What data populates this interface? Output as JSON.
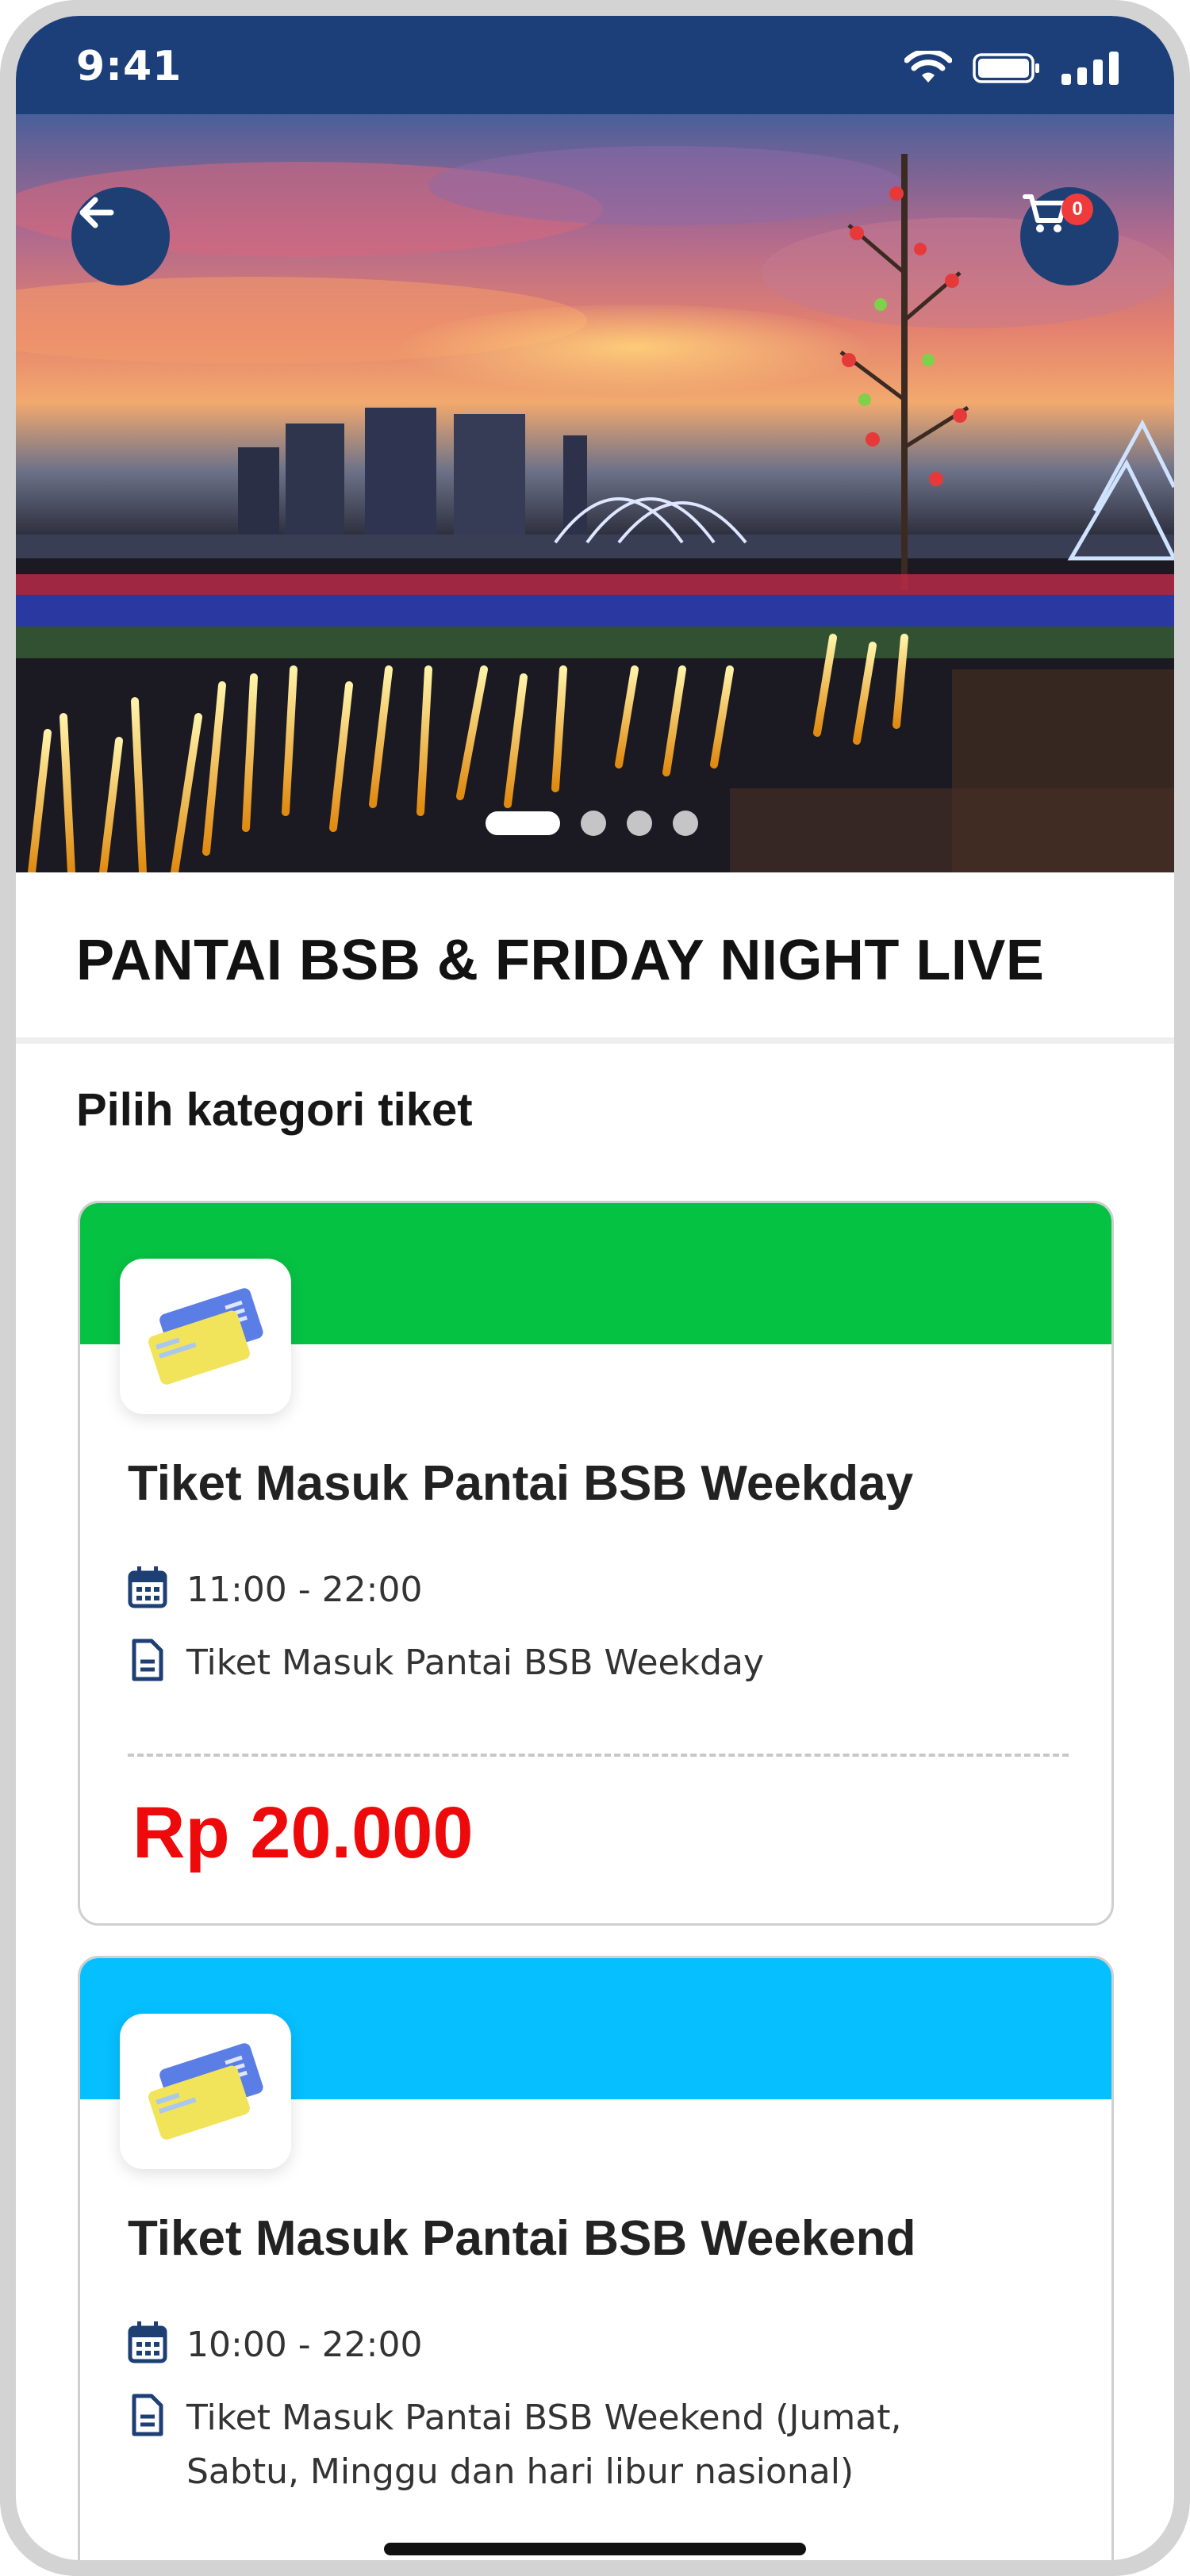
{
  "status_bar": {
    "time": "9:41",
    "background": "#1c3f79"
  },
  "header": {
    "back_icon": "arrow-left-icon",
    "cart_icon": "cart-icon",
    "cart_count": "0",
    "carousel": {
      "slides": 4,
      "active_index": 0
    }
  },
  "event": {
    "title": "PANTAI BSB & FRIDAY NIGHT LIVE"
  },
  "section": {
    "label": "Pilih kategori tiket"
  },
  "tickets": [
    {
      "name": "Tiket Masuk Pantai BSB Weekday",
      "time": "11:00 - 22:00",
      "description": "Tiket Masuk Pantai BSB Weekday",
      "price": "Rp 20.000",
      "accent": "#06c243"
    },
    {
      "name": "Tiket Masuk Pantai BSB Weekend",
      "time": "10:00 - 22:00",
      "description_line1": "Tiket Masuk Pantai BSB Weekend (Jumat,",
      "description_line2": "Sabtu, Minggu dan hari libur nasional)",
      "accent": "#06bfff"
    }
  ],
  "colors": {
    "price": "#ee0a0a",
    "icon_blue": "#1d3f74"
  }
}
